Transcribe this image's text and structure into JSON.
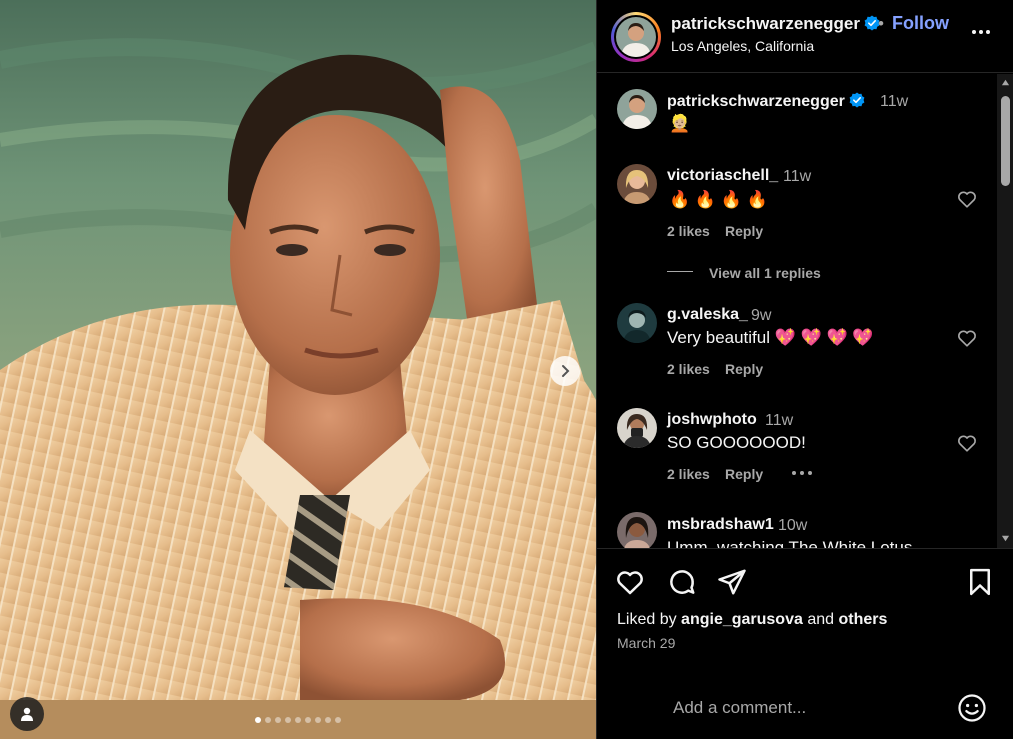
{
  "post": {
    "username": "patrickschwarzenegger",
    "follow_label": "Follow",
    "separator": "•",
    "location": "Los Angeles, California",
    "photo_alt": "Portrait of a man in a striped shirt and tie leaning on his elbow",
    "carousel": {
      "total": 9,
      "active": 0
    }
  },
  "caption": {
    "username": "patrickschwarzenegger",
    "time": "11w",
    "text": "👱🏼"
  },
  "comments": [
    {
      "username": "victoriaschell_",
      "time": "11w",
      "text": "🔥 🔥 🔥 🔥",
      "likes": "2 likes",
      "reply": "Reply",
      "view_replies": "View all 1 replies"
    },
    {
      "username": "g.valeska_",
      "time": "9w",
      "text": "Very beautiful 💖 💖 💖 💖",
      "likes": "2 likes",
      "reply": "Reply"
    },
    {
      "username": "joshwphoto",
      "time": "11w",
      "text": "SO GOOOOOOD!",
      "likes": "2 likes",
      "reply": "Reply"
    },
    {
      "username": "msbradshaw1",
      "time": "10w",
      "text": "Umm, watching The White Lotus..."
    }
  ],
  "footer": {
    "liked_by_prefix": "Liked by",
    "liked_by_user": "angie_garusova",
    "liked_by_and": "and",
    "liked_by_others": "others",
    "date": "March 29",
    "comment_placeholder": "Add a comment..."
  },
  "icons": {
    "like": "heart-icon",
    "comment": "comment-icon",
    "share": "paper-plane-icon",
    "save": "bookmark-icon",
    "more": "more-horizontal-icon",
    "emoji": "smiley-icon",
    "verified": "verified-badge-icon",
    "next": "chevron-right-icon",
    "tags": "user-tag-icon"
  },
  "colors": {
    "background": "#000000",
    "text": "#f5f5f5",
    "secondary_text": "#a8a8a8",
    "follow": "#85a1ff",
    "verified": "#0095f6",
    "divider": "#262626"
  }
}
